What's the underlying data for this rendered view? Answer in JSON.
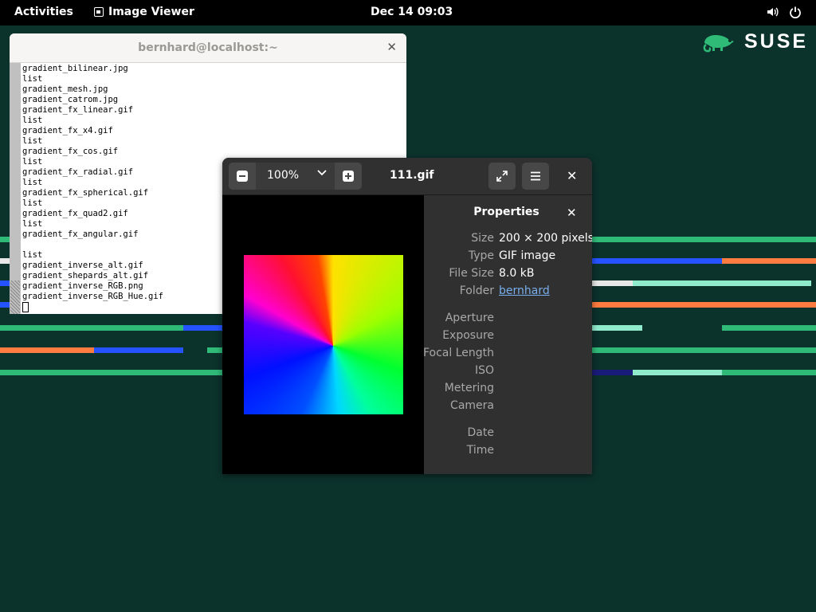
{
  "topbar": {
    "activities": "Activities",
    "app_name": "Image Viewer",
    "clock": "Dec 14  09:03",
    "icons": {
      "volume": "volume-icon",
      "power": "power-icon"
    }
  },
  "desktop": {
    "logo_text": "SUSE",
    "background_color": "#0c322c",
    "accent_colors": [
      "#30ba78",
      "#fe7c3f",
      "#2453ff",
      "#90ebcd"
    ]
  },
  "terminal": {
    "title": "bernhard@localhost:~",
    "lines": [
      "gradient_bilinear.jpg",
      "list",
      "gradient_mesh.jpg",
      "gradient_catrom.jpg",
      "gradient_fx_linear.gif",
      "list",
      "gradient_fx_x4.gif",
      "list",
      "gradient_fx_cos.gif",
      "list",
      "gradient_fx_radial.gif",
      "list",
      "gradient_fx_spherical.gif",
      "list",
      "gradient_fx_quad2.gif",
      "list",
      "gradient_fx_angular.gif",
      "",
      "list",
      "gradient_inverse_alt.gif",
      "gradient_shepards_alt.gif",
      "gradient_inverse_RGB.png",
      "gradient_inverse_RGB_Hue.gif"
    ]
  },
  "viewer": {
    "zoom": "100%",
    "filename": "111.gif",
    "icons": {
      "zoom_out": "zoom-out-icon",
      "zoom_in": "zoom-in-icon",
      "fullscreen": "fullscreen-icon",
      "menu": "hamburger-menu-icon",
      "close": "close-icon"
    },
    "properties": {
      "title": "Properties",
      "rows": [
        {
          "key": "Size",
          "value": "200 × 200 pixels"
        },
        {
          "key": "Type",
          "value": "GIF image"
        },
        {
          "key": "File Size",
          "value": "8.0 kB"
        },
        {
          "key": "Folder",
          "value": "bernhard"
        },
        {
          "key": "Aperture",
          "value": ""
        },
        {
          "key": "Exposure",
          "value": ""
        },
        {
          "key": "Focal Length",
          "value": ""
        },
        {
          "key": "ISO",
          "value": ""
        },
        {
          "key": "Metering",
          "value": ""
        },
        {
          "key": "Camera",
          "value": ""
        },
        {
          "key": "Date",
          "value": ""
        },
        {
          "key": "Time",
          "value": ""
        }
      ]
    }
  }
}
